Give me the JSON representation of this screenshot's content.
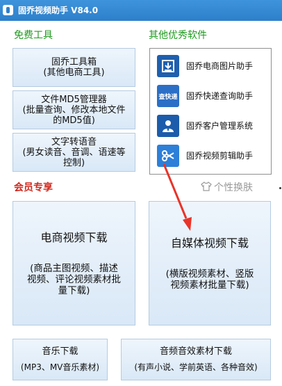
{
  "window": {
    "title": "固乔视频助手 V84.0"
  },
  "sections": {
    "free_tools": "免费工具",
    "other_software": "其他优秀软件",
    "member": "会员专享",
    "skin": "个性换肤"
  },
  "free_tools": [
    {
      "line1": "固乔工具箱",
      "line2": "(其他电商工具)"
    },
    {
      "line1": "文件MD5管理器",
      "line2": "(批量查询、修改本地文件",
      "line3": "的MD5值)"
    },
    {
      "line1": "文字转语音",
      "line2": "(男女读音、音调、语速等",
      "line3": "控制)"
    }
  ],
  "software": [
    {
      "label": "固乔电商图片助手",
      "icon": "download-icon"
    },
    {
      "label": "固乔快递查询助手",
      "icon_text": "查快递"
    },
    {
      "label": "固乔客户管理系统",
      "icon": "customer-icon"
    },
    {
      "label": "固乔视频剪辑助手",
      "icon": "scissors-icon"
    }
  ],
  "member_buttons": {
    "ecommerce": {
      "title": "电商视频下载",
      "sub1": "(商品主图视频、描述",
      "sub2": "视频、评论视频素材批",
      "sub3": "量下载)"
    },
    "selfmedia": {
      "title": "自媒体视频下载",
      "sub1": "(横版视频素材、竖版",
      "sub2": "视频素材批量下载)"
    },
    "music": {
      "title": "音乐下载",
      "sub": "(MP3、MV音乐素材)"
    },
    "audio": {
      "title": "音频音效素材下载",
      "sub": "(有声小说、学前英语、各种音效)"
    }
  },
  "colors": {
    "titlebar": "#2d7fcb",
    "green_label": "#1f9a1f",
    "red_label": "#d0281d",
    "button_border": "#b5cbe0",
    "arrow": "#e8342a"
  }
}
